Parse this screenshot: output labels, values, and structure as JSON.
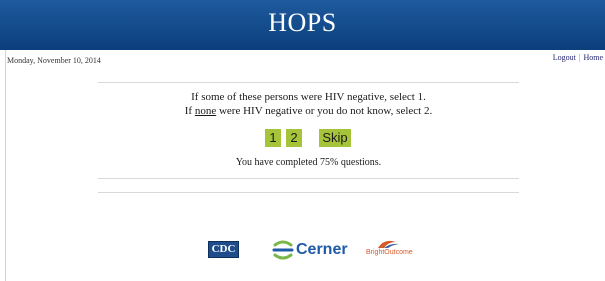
{
  "header": {
    "title": "HOPS"
  },
  "topbar": {
    "date": "Monday, November 10, 2014",
    "logout": "Logout",
    "separator": "|",
    "home": "Home"
  },
  "question": {
    "line1": "If some of these persons were HIV negative, select 1.",
    "line2_prefix": "If",
    "line2_underlined": "none",
    "line2_suffix": "were HIV negative or you do not know, select 2."
  },
  "options": [
    "1",
    "2",
    "Skip"
  ],
  "progress": {
    "text": "You have completed 75% questions.",
    "percent": 75
  },
  "footer": {
    "logos": [
      {
        "name": "CDC",
        "text": "CDC"
      },
      {
        "name": "Cerner",
        "text": "Cerner"
      },
      {
        "name": "BrightOutcome",
        "text": "BrightOutcome"
      }
    ]
  },
  "colors": {
    "banner": "#0b3f7c",
    "option_button": "#a6c43a",
    "cerner_blue": "#1f5aa6",
    "cerner_green": "#7ab648",
    "bright_orange": "#d55a2a"
  }
}
